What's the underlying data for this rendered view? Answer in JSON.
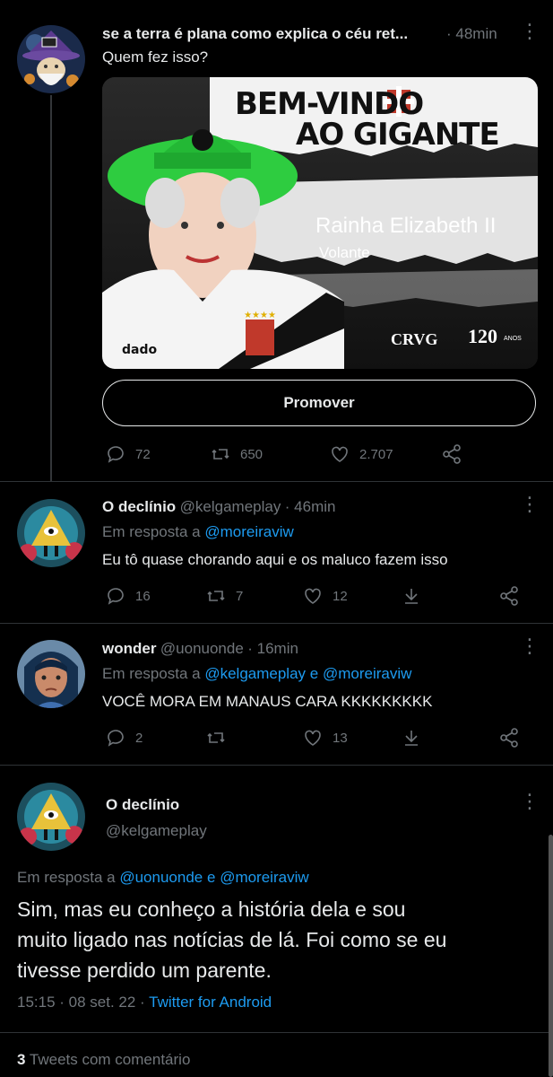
{
  "tweet1": {
    "name": "se a terra é plana como explica o céu ret...",
    "time": "· 48min",
    "text": "Quem fez isso?",
    "card": {
      "headline1": "BEM-VINDO",
      "headline2": "AO GIGANTE",
      "player_name": "Rainha  Elizabeth  II",
      "position": "Volante",
      "club": "CRVG",
      "years": "120",
      "years_suffix": "ANOS"
    },
    "promote_label": "Promover",
    "replies": "72",
    "retweets": "650",
    "likes": "2.707"
  },
  "reply1": {
    "name": "O declínio",
    "handle": "@kelgameplay",
    "time": "· 46min",
    "reply_prefix": "Em resposta a",
    "reply_to": "@moreiraviw",
    "text": "Eu tô quase chorando aqui e os maluco fazem isso",
    "replies": "16",
    "retweets": "7",
    "likes": "12"
  },
  "reply2": {
    "name": "wonder",
    "handle": "@uonuonde",
    "time": "· 16min",
    "reply_prefix": "Em resposta a",
    "reply_to_1": "@kelgameplay",
    "reply_joiner": "e",
    "reply_to_2": "@moreiraviw",
    "text": "VOCÊ MORA EM MANAUS CARA KKKKKKKKK",
    "replies": "2",
    "likes": "13"
  },
  "main": {
    "name": "O declínio",
    "handle": "@kelgameplay",
    "reply_prefix": "Em resposta a",
    "reply_to_1": "@uonuonde",
    "reply_joiner": "e",
    "reply_to_2": "@moreiraviw",
    "text_line1": "Sim, mas eu conheço a história dela e sou",
    "text_line2": "muito ligado nas notícias de lá. Foi como se eu",
    "text_line3": "tivesse perdido um parente.",
    "timestamp": "15:15 · 08 set. 22 ·",
    "source": "Twitter for Android"
  },
  "footer": {
    "count": "3",
    "label": "Tweets com comentário"
  }
}
